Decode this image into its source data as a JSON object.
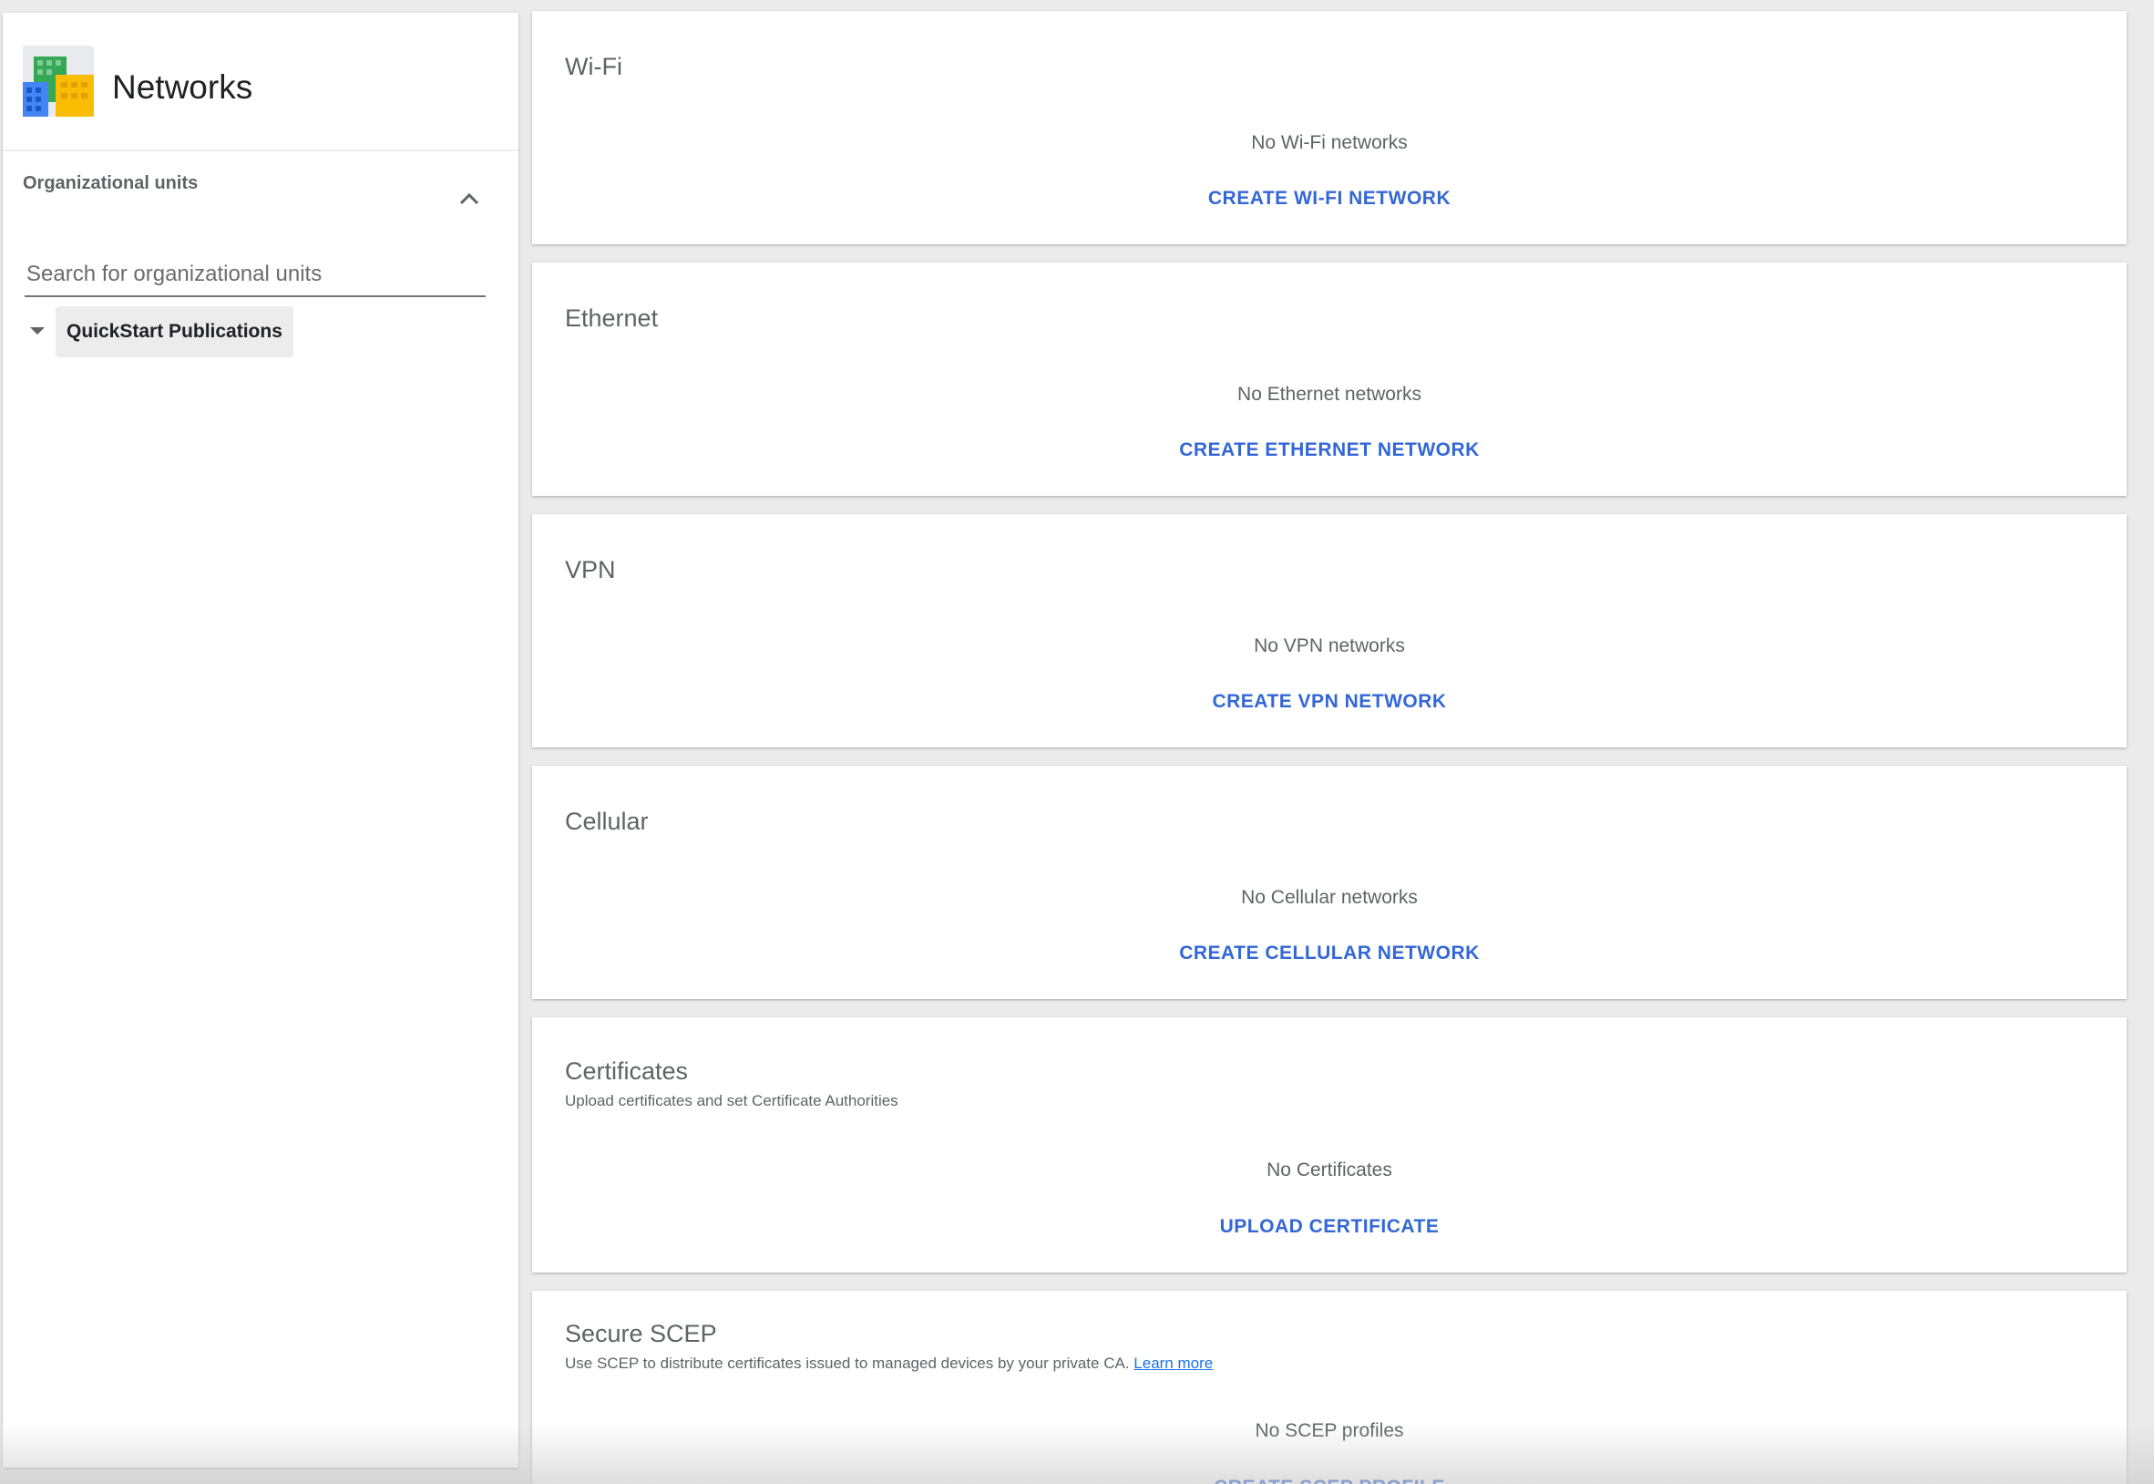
{
  "app": {
    "title": "Networks",
    "logo_icon": "building-icon"
  },
  "sidebar": {
    "section_label": "Organizational units",
    "collapse_icon": "chevron-up-icon",
    "search_placeholder": "Search for organizational units",
    "tree": {
      "expand_icon": "caret-down-icon",
      "root_label": "QuickStart Publications"
    }
  },
  "cards": {
    "wifi": {
      "title": "Wi-Fi",
      "empty": "No Wi-Fi networks",
      "action": "CREATE WI-FI NETWORK"
    },
    "ethernet": {
      "title": "Ethernet",
      "empty": "No Ethernet networks",
      "action": "CREATE ETHERNET NETWORK"
    },
    "vpn": {
      "title": "VPN",
      "empty": "No VPN networks",
      "action": "CREATE VPN NETWORK"
    },
    "cellular": {
      "title": "Cellular",
      "empty": "No Cellular networks",
      "action": "CREATE CELLULAR NETWORK"
    },
    "certificates": {
      "title": "Certificates",
      "subtitle": "Upload certificates and set Certificate Authorities",
      "empty": "No Certificates",
      "action": "UPLOAD CERTIFICATE"
    },
    "scep": {
      "title": "Secure SCEP",
      "subtitle": "Use SCEP to distribute certificates issued to managed devices by your private CA.",
      "learn_more": "Learn more",
      "empty": "No SCEP profiles",
      "action": "CREATE SCEP PROFILE"
    }
  },
  "colors": {
    "accent": "#3367d6",
    "link": "#1a73e8",
    "muted_text": "#5f6368",
    "background": "#ebebeb",
    "card": "#ffffff"
  }
}
